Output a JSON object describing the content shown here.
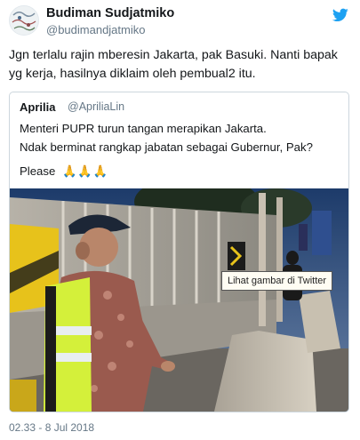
{
  "author": {
    "name": "Budiman Sudjatmiko",
    "handle": "@budimandjatmiko"
  },
  "tweet": {
    "text": "Jgn terlalu rajin mberesin Jakarta, pak Basuki. Nanti bapak yg kerja, hasilnya diklaim oleh pembual2 itu."
  },
  "quoted": {
    "name": "Aprilia",
    "handle": "@ApriliaLin",
    "line1": "Menteri PUPR turun tangan merapikan Jakarta.",
    "line2": "Ndak berminat rangkap jabatan sebagai Gubernur, Pak?",
    "please": "Please",
    "emoji": "🙏🙏🙏",
    "image_tooltip": "Lihat gambar di Twitter"
  },
  "timestamp": "02.33 - 8 Jul 2018",
  "colors": {
    "twitter_blue": "#1da1f2",
    "text": "#14171a",
    "secondary_text": "#657786",
    "border": "#ccd6dd",
    "vest": "#d4f03a"
  },
  "icons": {
    "twitter": "twitter-bird-icon",
    "avatar": "avatar",
    "emoji": "folded-hands-emoji"
  }
}
